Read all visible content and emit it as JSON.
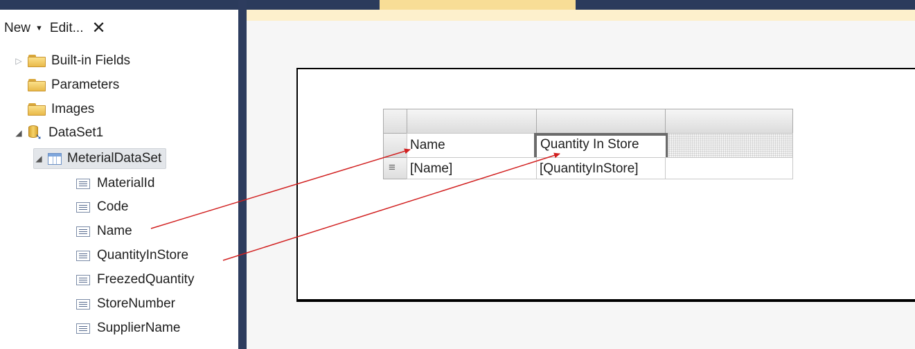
{
  "toolbar": {
    "new_label": "New",
    "edit_label": "Edit..."
  },
  "tree": {
    "builtin_fields": "Built-in Fields",
    "parameters": "Parameters",
    "images": "Images",
    "dataset": "DataSet1",
    "material_dataset": "MeterialDataSet",
    "fields": [
      "MaterialId",
      "Code",
      "Name",
      "QuantityInStore",
      "FreezedQuantity",
      "StoreNumber",
      "SupplierName"
    ]
  },
  "tablix": {
    "header_row": [
      "Name",
      "Quantity In Store"
    ],
    "detail_row": [
      "[Name]",
      "[QuantityInStore]"
    ]
  },
  "colors": {
    "accent": "#d11f1f",
    "tab_bg": "#2b3b5c",
    "active_tab": "#f8dd96"
  }
}
